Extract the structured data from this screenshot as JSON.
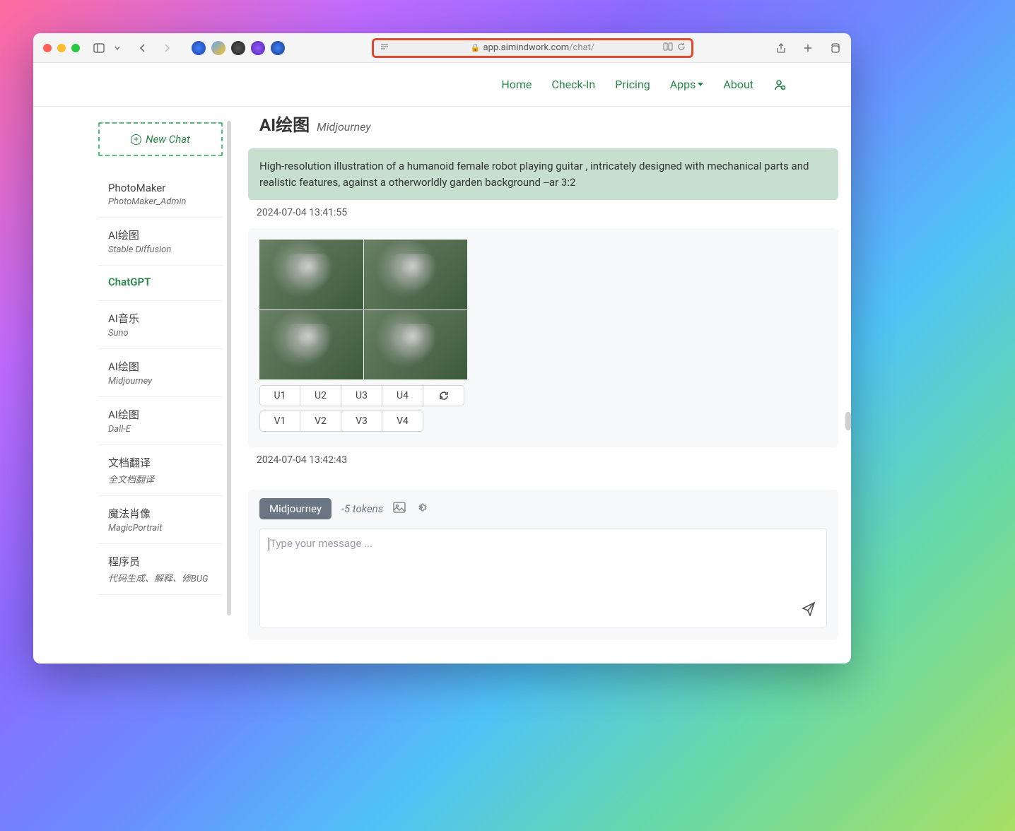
{
  "browser": {
    "url_host": "app.aimindwork.com",
    "url_path": "/chat/"
  },
  "nav": {
    "home": "Home",
    "checkin": "Check-In",
    "pricing": "Pricing",
    "apps": "Apps",
    "about": "About"
  },
  "sidebar": {
    "new_chat": "New Chat",
    "items": [
      {
        "title": "PhotoMaker",
        "sub": "PhotoMaker_Admin",
        "active": false
      },
      {
        "title": "AI绘图",
        "sub": "Stable Diffusion",
        "active": false
      },
      {
        "title": "ChatGPT",
        "sub": "",
        "active": true
      },
      {
        "title": "AI音乐",
        "sub": "Suno",
        "active": false
      },
      {
        "title": "AI绘图",
        "sub": "Midjourney",
        "active": false
      },
      {
        "title": "AI绘图",
        "sub": "Dall-E",
        "active": false
      },
      {
        "title": "文档翻译",
        "sub": "全文档翻译",
        "active": false
      },
      {
        "title": "魔法肖像",
        "sub": "MagicPortrait",
        "active": false
      },
      {
        "title": "程序员",
        "sub": "代码生成、解释、修BUG",
        "active": false
      }
    ]
  },
  "chat": {
    "title": "AI绘图",
    "subtitle": "Midjourney",
    "prompt_text": "High-resolution illustration of a humanoid female robot playing guitar , intricately designed with mechanical parts and realistic features, against a otherworldly garden background --ar 3:2",
    "prompt_time": "2024-07-04 13:41:55",
    "response_time": "2024-07-04 13:42:43",
    "u_buttons": [
      "U1",
      "U2",
      "U3",
      "U4"
    ],
    "v_buttons": [
      "V1",
      "V2",
      "V3",
      "V4"
    ]
  },
  "composer": {
    "model": "Midjourney",
    "tokens": "-5 tokens",
    "placeholder": "Type your message ..."
  }
}
